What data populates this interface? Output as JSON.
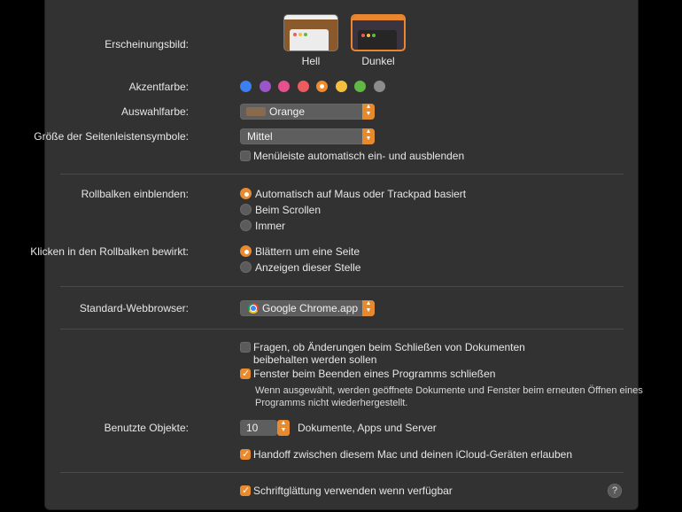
{
  "appearance": {
    "label": "Erscheinungsbild:",
    "options": [
      {
        "name": "Hell",
        "selected": false
      },
      {
        "name": "Dunkel",
        "selected": true
      }
    ]
  },
  "accent": {
    "label": "Akzentfarbe:",
    "colors": [
      "#3b7ff0",
      "#9b55c9",
      "#e6508f",
      "#ec5b5f",
      "#f08a2f",
      "#f4c03b",
      "#62b845",
      "#8c8c8c"
    ],
    "selected_index": 4
  },
  "highlight": {
    "label": "Auswahlfarbe:",
    "value": "Orange",
    "chip_color": "#8a6a4f"
  },
  "sidebar_icon_size": {
    "label": "Größe der Seitenleistensymbole:",
    "value": "Mittel"
  },
  "menubar_autohide": {
    "label": "Menüleiste automatisch ein- und ausblenden",
    "checked": false
  },
  "scrollbars": {
    "label": "Rollbalken einblenden:",
    "options": [
      {
        "text": "Automatisch auf Maus oder Trackpad basiert",
        "selected": true
      },
      {
        "text": "Beim Scrollen",
        "selected": false
      },
      {
        "text": "Immer",
        "selected": false
      }
    ]
  },
  "scroll_click": {
    "label": "Klicken in den Rollbalken bewirkt:",
    "options": [
      {
        "text": "Blättern um eine Seite",
        "selected": true
      },
      {
        "text": "Anzeigen dieser Stelle",
        "selected": false
      }
    ]
  },
  "browser": {
    "label": "Standard-Webbrowser:",
    "value": "Google Chrome.app",
    "icon": "chrome-icon"
  },
  "ask_keep_changes": {
    "line1": "Fragen, ob Änderungen beim Schließen von Dokumenten",
    "line2": "beibehalten werden sollen",
    "checked": false
  },
  "close_windows": {
    "label": "Fenster beim Beenden eines Programms schließen",
    "checked": true,
    "hint_line1": "Wenn ausgewählt, werden geöffnete Dokumente und Fenster beim erneuten Öffnen eines",
    "hint_line2": "Programms nicht wiederhergestellt."
  },
  "recent_items": {
    "label": "Benutzte Objekte:",
    "value": "10",
    "suffix": "Dokumente, Apps und Server"
  },
  "handoff": {
    "label": "Handoff zwischen diesem Mac und deinen iCloud-Geräten erlauben",
    "checked": true
  },
  "font_smoothing": {
    "label": "Schriftglättung verwenden wenn verfügbar",
    "checked": true
  },
  "help": {
    "glyph": "?"
  },
  "colors": {
    "accent": "#e98a2f",
    "panel_bg": "#323232"
  }
}
